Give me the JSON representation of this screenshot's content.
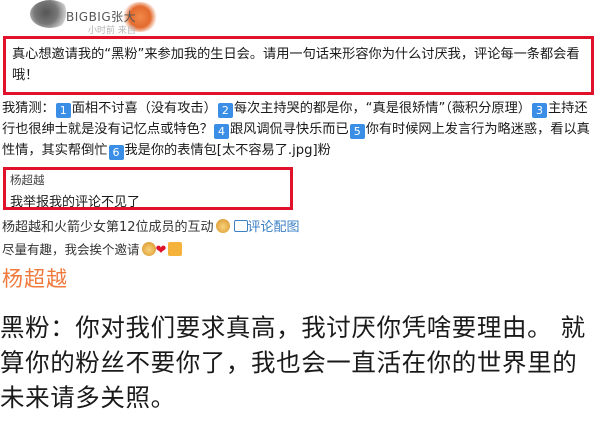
{
  "header": {
    "username": "BIGBIG张大",
    "sub_text": "小时前 来自"
  },
  "post": {
    "text": "真心想邀请我的“黑粉”来参加我的生日会。请用一句话来形容你为什么讨厌我，评论每一条都会看哦！"
  },
  "guesses": {
    "prefix": "我猜测：",
    "items": [
      {
        "num": "1",
        "text": "面相不讨喜（没有攻击）"
      },
      {
        "num": "2",
        "text": "每次主持哭的都是你，“真是很矫情”（薇积分原理）"
      },
      {
        "num": "3",
        "text": "主持还行也很绅士就是没有记忆点或特色？"
      },
      {
        "num": "4",
        "text": "跟风调侃寻快乐而已"
      },
      {
        "num": "5",
        "text": "你有时候网上发言行为略迷惑，看以真性情，其实帮倒忙"
      },
      {
        "num": "6",
        "text": "我是你的表情包[太不容易了.jpg]粉"
      }
    ]
  },
  "comment": {
    "name": "杨超越",
    "text": "我举报我的评论不见了"
  },
  "repost": {
    "text": "杨超越和火箭少女第12位成员的互动",
    "link": "评论配图"
  },
  "reply_line": {
    "text": "尽量有趣，我会挨个邀请"
  },
  "big": {
    "name": "杨超越",
    "quote": "黑粉：你对我们要求真高，我讨厌你凭啥要理由。 就算你的粉丝不要你了，我也会一直活在你的世界里的未来请多关照。"
  }
}
